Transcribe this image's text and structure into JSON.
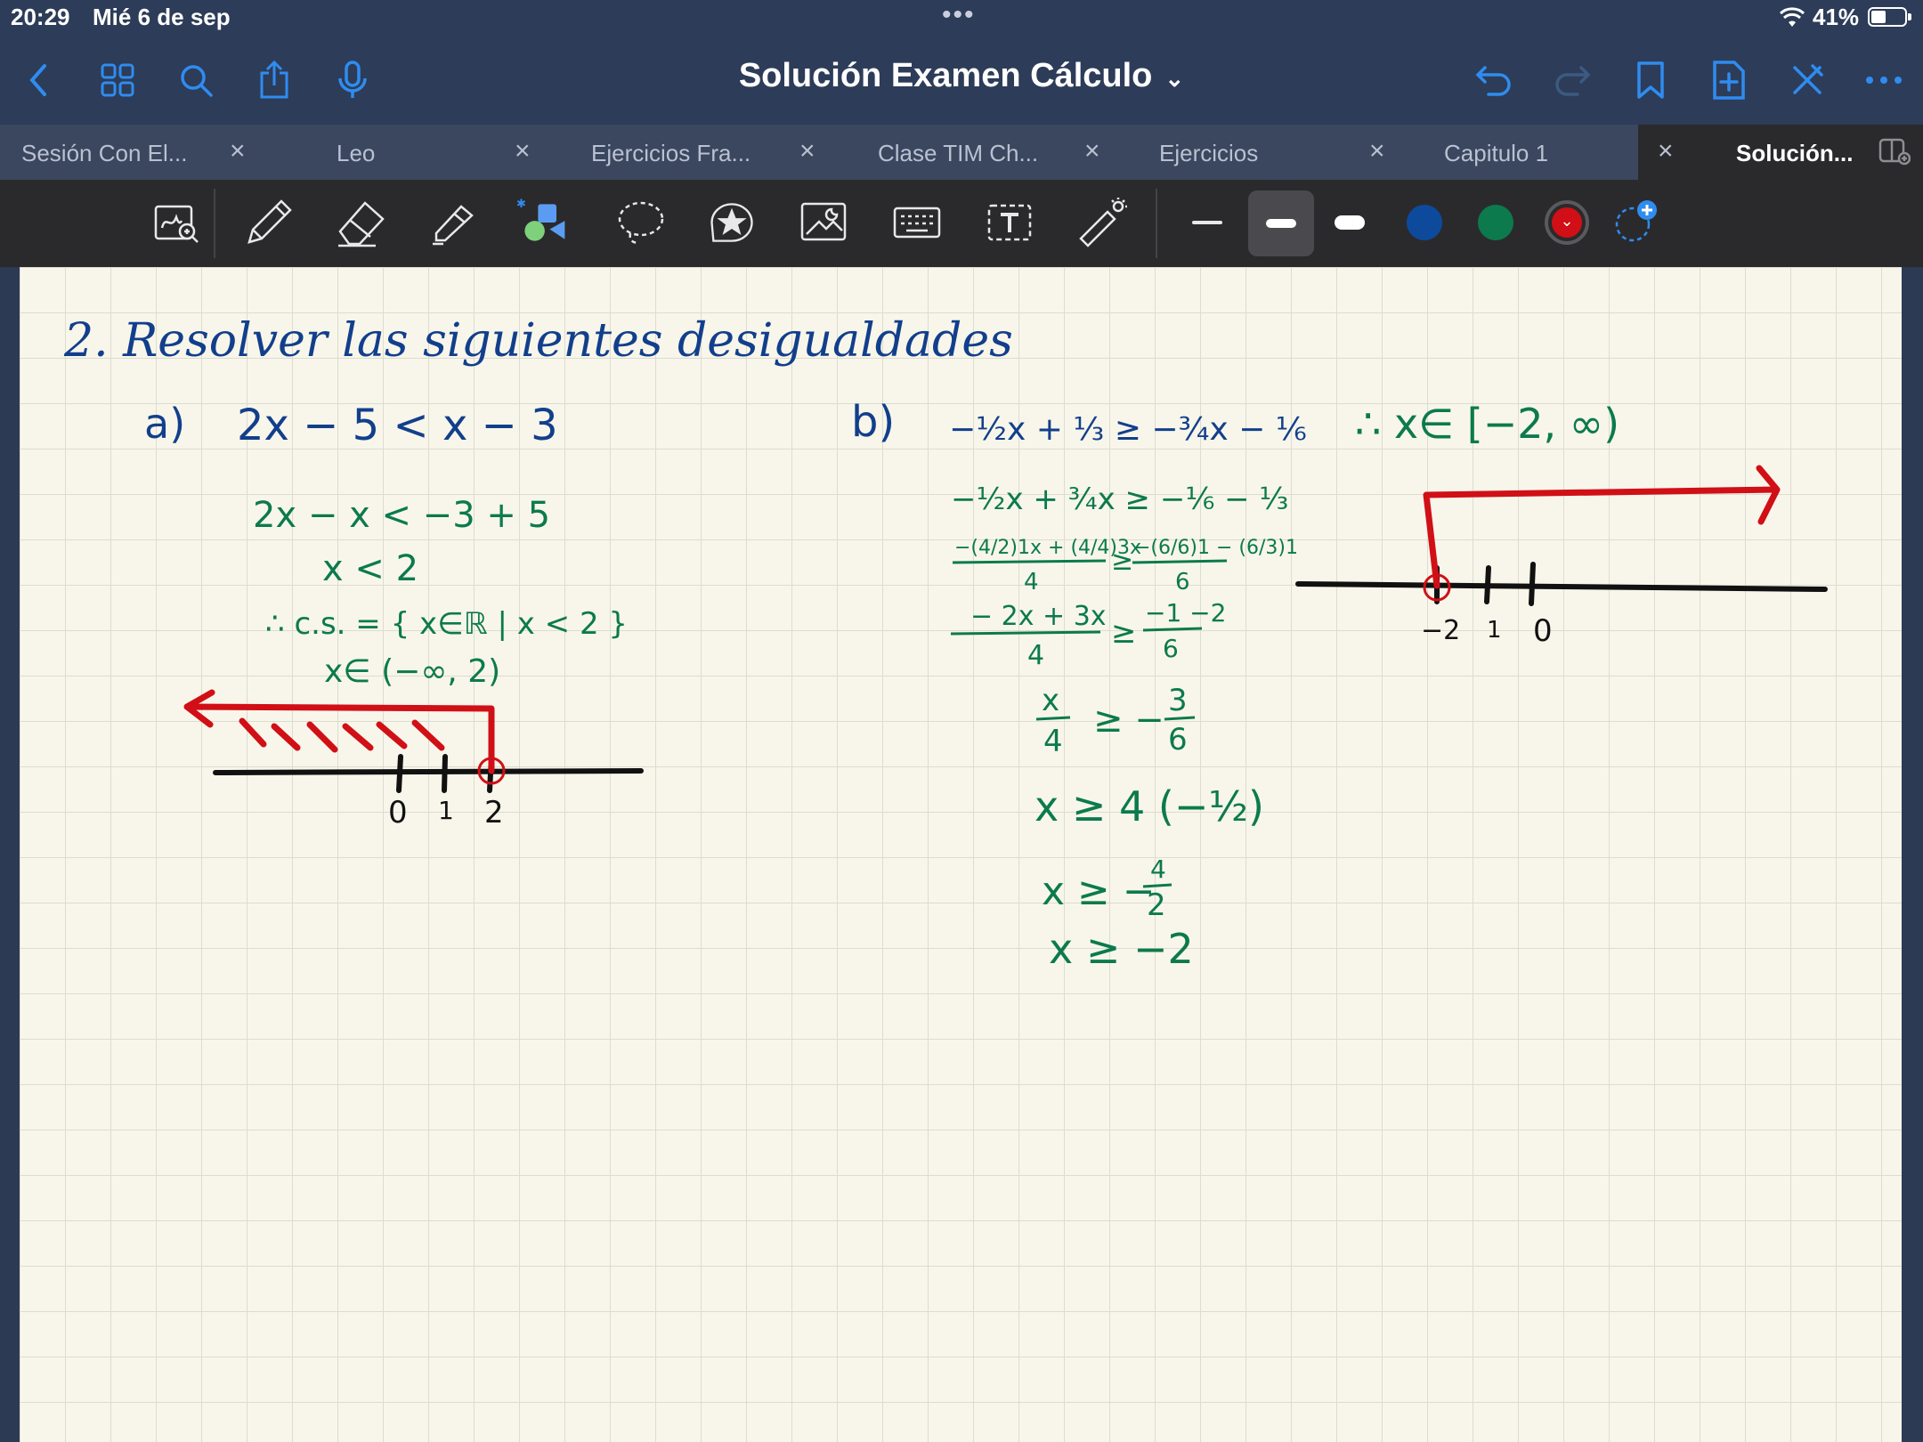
{
  "status": {
    "time": "20:29",
    "date": "Mié 6 de sep",
    "battery": "41%"
  },
  "nav": {
    "title": "Solución Examen Cálculo"
  },
  "tabs": [
    {
      "label": "Sesión Con El..."
    },
    {
      "label": "Leo"
    },
    {
      "label": "Ejercicios Fra..."
    },
    {
      "label": "Clase TIM Ch..."
    },
    {
      "label": "Ejercicios"
    },
    {
      "label": "Capitulo 1"
    },
    {
      "label": "Solución..."
    }
  ],
  "colors": {
    "blue_ink": "#123f8c",
    "green_ink": "#0c7a4d",
    "red_ink": "#d10f16",
    "black_ink": "#111111"
  },
  "note": {
    "heading": "2. Resolver las siguientes desigualdades",
    "a": {
      "label": "a)",
      "problem": "2x − 5 < x − 3",
      "step1": "2x − x < −3 + 5",
      "step2": "x < 2",
      "cs": "∴  c.s. = { x∈ℝ | x < 2 }",
      "interval": "x∈  (−∞, 2)",
      "ticks": [
        "0",
        "1",
        "2"
      ]
    },
    "b": {
      "label": "b)",
      "problem": "−½x + ⅓ ≥ −¾x − ⅙",
      "step1": "−½x + ¾x ≥ −⅙ − ⅓",
      "step2_num": "−(4/2)1x + (4/4)3x",
      "step2_den": "4",
      "step2_rnum": "−(6/6)1 − (6/3)1",
      "step2_rden": "6",
      "step3_num": "− 2x + 3x",
      "step3_den": "4",
      "step3_rnum": "−1 −2",
      "step3_rden": "6",
      "step4_num": "x",
      "step4_den": "4",
      "step4_r": "≥ −",
      "step4_rnum": "3",
      "step4_rden": "6",
      "step5": "x ≥ 4 (−½)",
      "step6": "x ≥ −",
      "step6_num": "4",
      "step6_den": "2",
      "step7": "x ≥ −2",
      "result": "∴  x∈  [−2, ∞)",
      "ticks": [
        "−2",
        "1",
        "0"
      ]
    }
  }
}
